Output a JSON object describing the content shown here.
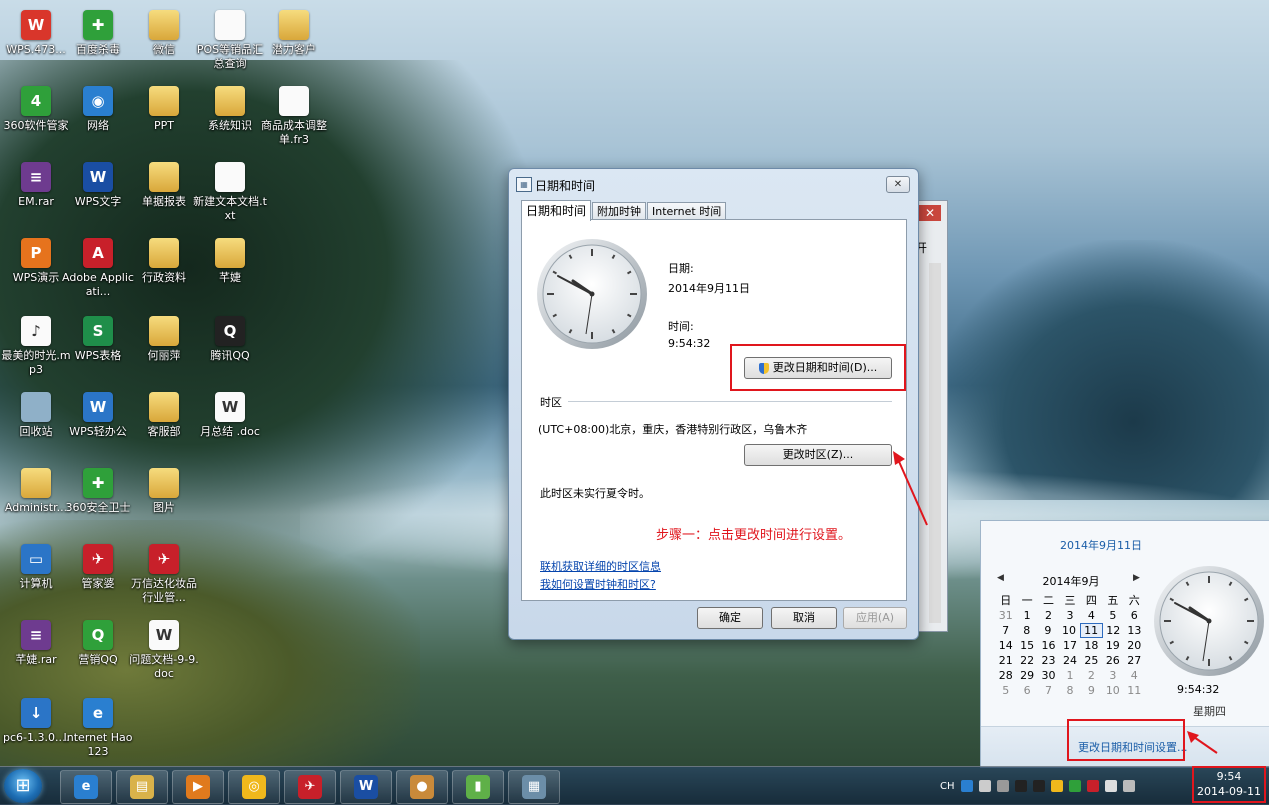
{
  "desktop": {
    "icons": [
      {
        "label": "WPS.473...",
        "glyph": "W",
        "kind": "wps"
      },
      {
        "label": "百度杀毒",
        "glyph": "✚",
        "kind": "s360"
      },
      {
        "label": "微信",
        "glyph": "",
        "kind": "folder"
      },
      {
        "label": "POS等销品汇总查询",
        "glyph": "",
        "kind": "doc"
      },
      {
        "label": "潜力客户",
        "glyph": "",
        "kind": "folder"
      },
      {
        "label": "360软件管家",
        "glyph": "4",
        "kind": "s360"
      },
      {
        "label": "网络",
        "glyph": "◉",
        "kind": "net"
      },
      {
        "label": "PPT",
        "glyph": "",
        "kind": "folder"
      },
      {
        "label": "系统知识",
        "glyph": "",
        "kind": "folder"
      },
      {
        "label": "商品成本调整单.fr3",
        "glyph": "",
        "kind": "doc"
      },
      {
        "label": "EM.rar",
        "glyph": "≡",
        "kind": "rar"
      },
      {
        "label": "WPS文字",
        "glyph": "W",
        "kind": "wpsb"
      },
      {
        "label": "单据报表",
        "glyph": "",
        "kind": "folder"
      },
      {
        "label": "新建文本文档.txt",
        "glyph": "",
        "kind": "doc"
      },
      {
        "label": "WPS演示",
        "glyph": "P",
        "kind": "wpso"
      },
      {
        "label": "Adobe Applicati...",
        "glyph": "A",
        "kind": "red"
      },
      {
        "label": "行政资料",
        "glyph": "",
        "kind": "folder"
      },
      {
        "label": "芊婕",
        "glyph": "",
        "kind": "folder"
      },
      {
        "label": "最美的时光.mp3",
        "glyph": "♪",
        "kind": "doc"
      },
      {
        "label": "WPS表格",
        "glyph": "S",
        "kind": "wpsg"
      },
      {
        "label": "何丽萍",
        "glyph": "",
        "kind": "folder"
      },
      {
        "label": "腾讯QQ",
        "glyph": "Q",
        "kind": "qq"
      },
      {
        "label": "回收站",
        "glyph": "",
        "kind": "bin"
      },
      {
        "label": "WPS轻办公",
        "glyph": "W",
        "kind": "blue"
      },
      {
        "label": "客服部",
        "glyph": "",
        "kind": "folder"
      },
      {
        "label": "月总结 .doc",
        "glyph": "W",
        "kind": "doc"
      },
      {
        "label": "Administr...",
        "glyph": "",
        "kind": "folder"
      },
      {
        "label": "360安全卫士",
        "glyph": "✚",
        "kind": "s360"
      },
      {
        "label": "图片",
        "glyph": "",
        "kind": "folder"
      },
      {
        "label": "计算机",
        "glyph": "▭",
        "kind": "blue"
      },
      {
        "label": "管家婆",
        "glyph": "✈",
        "kind": "red"
      },
      {
        "label": "万信达化妆品行业管...",
        "glyph": "✈",
        "kind": "red"
      },
      {
        "label": "芊婕.rar",
        "glyph": "≡",
        "kind": "rar"
      },
      {
        "label": "营销QQ",
        "glyph": "Q",
        "kind": "s360"
      },
      {
        "label": "问题文档-9-9.doc",
        "glyph": "W",
        "kind": "doc"
      },
      {
        "label": "pc6-1.3.0....",
        "glyph": "↓",
        "kind": "blue"
      },
      {
        "label": "Internet Hao123",
        "glyph": "e",
        "kind": "net"
      }
    ]
  },
  "dialog": {
    "title": "日期和时间",
    "close": "✕",
    "tabs": [
      "日期和时间",
      "附加时钟",
      "Internet 时间"
    ],
    "date_label": "日期:",
    "date_value": "2014年9月11日",
    "time_label": "时间:",
    "time_value": "9:54:32",
    "change_datetime_btn": "更改日期和时间(D)...",
    "timezone_heading": "时区",
    "timezone_value": "(UTC+08:00)北京，重庆，香港特别行政区，乌鲁木齐",
    "change_timezone_btn": "更改时区(Z)...",
    "dst_note": "此时区未实行夏令时。",
    "step_note": "步骤一：点击更改时间进行设置。",
    "link1": "联机获取详细的时区信息",
    "link2": "我如何设置时钟和时区?",
    "ok": "确定",
    "cancel": "取消",
    "apply": "应用(A)"
  },
  "behind_window": {
    "close": "✕",
    "open_label": "开"
  },
  "calendar_popup": {
    "date_header": "2014年9月11日",
    "month": "2014年9月",
    "prev": "◀",
    "next": "▶",
    "weekdays": [
      "日",
      "一",
      "二",
      "三",
      "四",
      "五",
      "六"
    ],
    "weeks": [
      [
        "31",
        "1",
        "2",
        "3",
        "4",
        "5",
        "6"
      ],
      [
        "7",
        "8",
        "9",
        "10",
        "11",
        "12",
        "13"
      ],
      [
        "14",
        "15",
        "16",
        "17",
        "18",
        "19",
        "20"
      ],
      [
        "21",
        "22",
        "23",
        "24",
        "25",
        "26",
        "27"
      ],
      [
        "28",
        "29",
        "30",
        "1",
        "2",
        "3",
        "4"
      ],
      [
        "5",
        "6",
        "7",
        "8",
        "9",
        "10",
        "11"
      ]
    ],
    "today": "11",
    "time": "9:54:32",
    "weekday": "星期四",
    "settings_link": "更改日期和时间设置..."
  },
  "taskbar": {
    "start_glyph": "⊞",
    "pinned": [
      {
        "name": "ie",
        "glyph": "e",
        "color": "#2a7fd0"
      },
      {
        "name": "explorer",
        "glyph": "▤",
        "color": "#d9b24a"
      },
      {
        "name": "media-player",
        "glyph": "▶",
        "color": "#e07a1d"
      },
      {
        "name": "app-yellow",
        "glyph": "◎",
        "color": "#f0b81c"
      },
      {
        "name": "app-red",
        "glyph": "✈",
        "color": "#c8202a"
      },
      {
        "name": "wps-writer",
        "glyph": "W",
        "color": "#1a4ea3"
      },
      {
        "name": "bear-app",
        "glyph": "●",
        "color": "#c98a3a"
      },
      {
        "name": "chart-app",
        "glyph": "▮",
        "color": "#5fb048"
      },
      {
        "name": "datetime-app",
        "glyph": "▦",
        "color": "#6c8ea8"
      }
    ],
    "tray_text": "CH",
    "clock_time": "9:54",
    "clock_date": "2014-09-11"
  },
  "colors": {
    "highlight": "#e0161d",
    "link": "#0645ad"
  }
}
